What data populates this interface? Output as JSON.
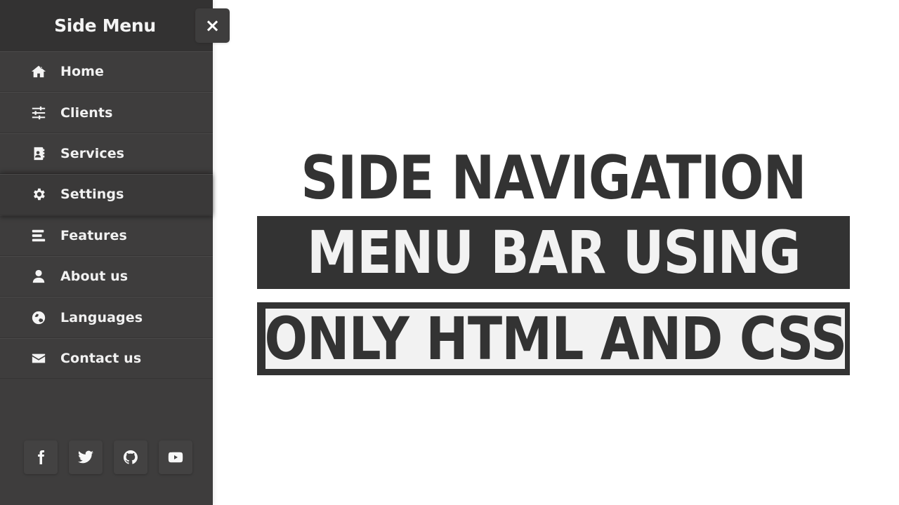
{
  "sidebar": {
    "title": "Side Menu",
    "close_icon": "×",
    "items": [
      {
        "label": "Home",
        "icon": "home-icon"
      },
      {
        "label": "Clients",
        "icon": "sliders-icon"
      },
      {
        "label": "Services",
        "icon": "address-book-icon"
      },
      {
        "label": "Settings",
        "icon": "gear-icon",
        "active": true
      },
      {
        "label": "Features",
        "icon": "bars-icon"
      },
      {
        "label": "About us",
        "icon": "user-icon"
      },
      {
        "label": "Languages",
        "icon": "globe-icon"
      },
      {
        "label": "Contact us",
        "icon": "envelope-icon"
      }
    ],
    "socials": [
      "facebook-icon",
      "twitter-icon",
      "github-icon",
      "youtube-icon"
    ]
  },
  "headline": {
    "line1": "SIDE NAVIGATION",
    "line2": "MENU BAR USING",
    "line3": "ONLY HTML AND CSS"
  },
  "colors": {
    "sidebar_bg": "#3e3d3d",
    "header_bg": "#333232",
    "text_dark": "#333333",
    "text_light": "#f2f2f2"
  }
}
